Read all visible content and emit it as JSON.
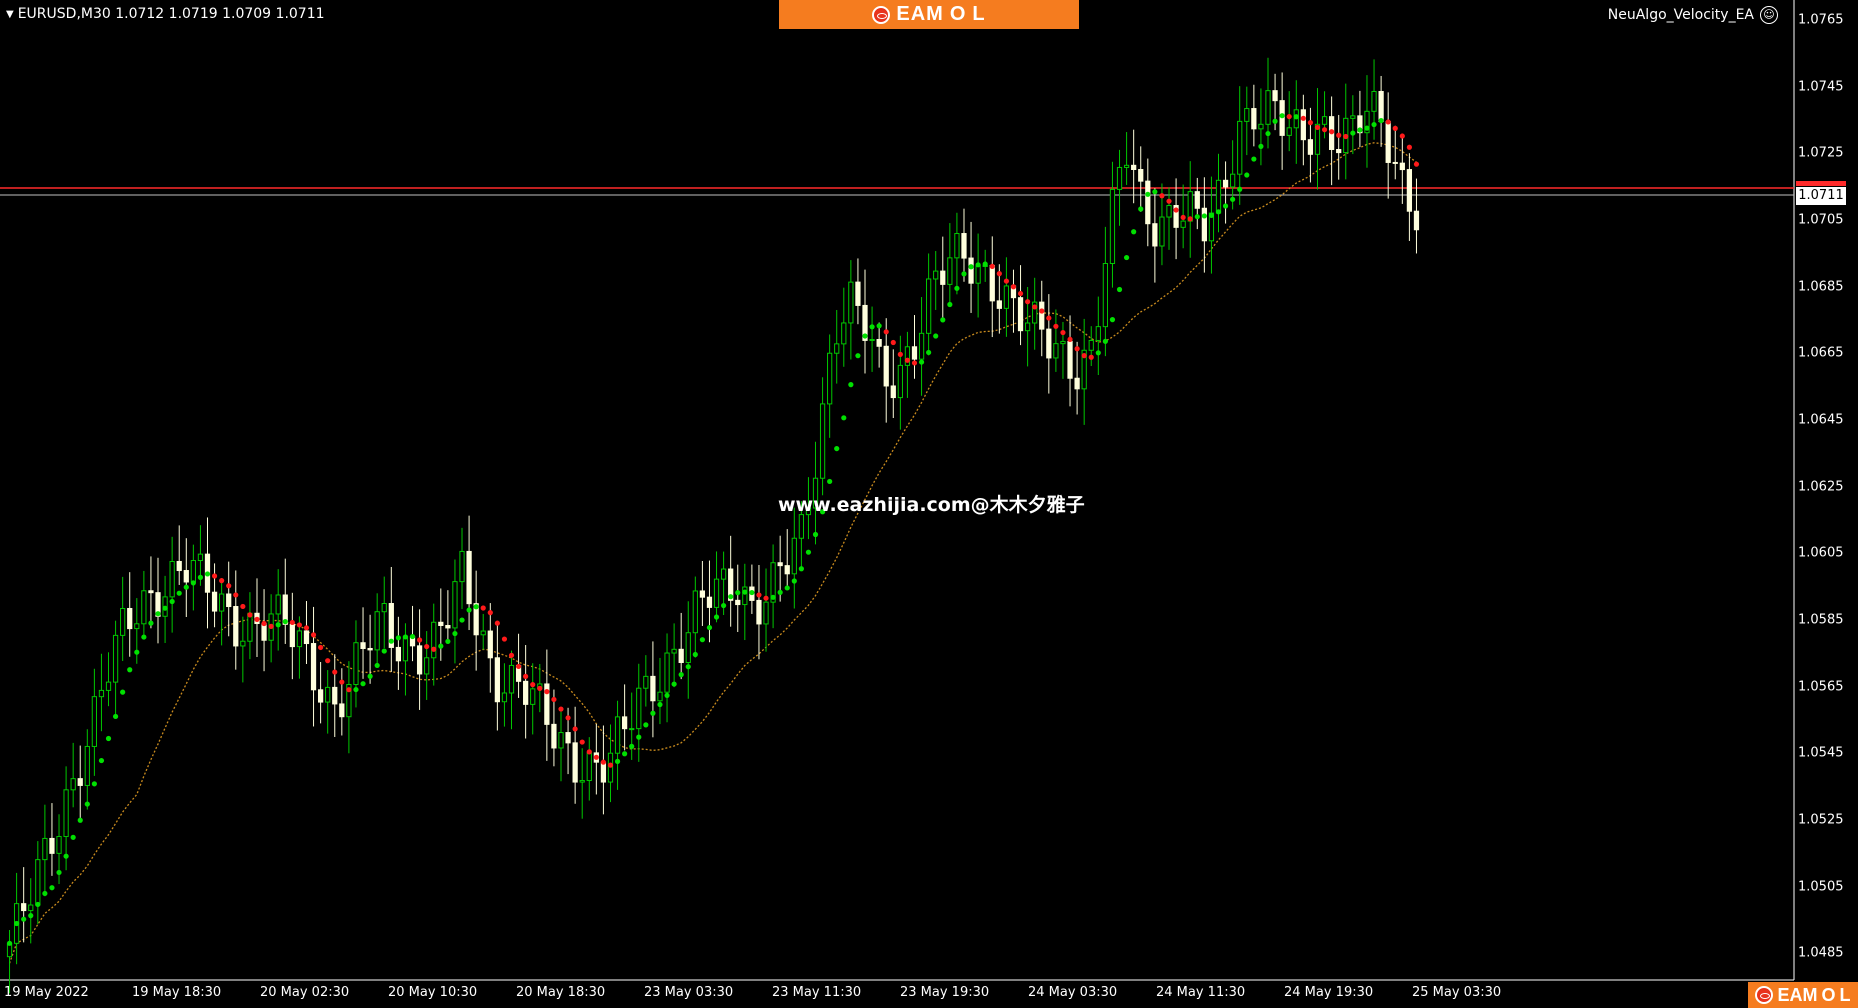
{
  "header": {
    "symbol_info": "EURUSD,M30  1.0712 1.0719 1.0709 1.0711",
    "ea_name": "NeuAlgo_Velocity_EA",
    "smiley": "☺"
  },
  "brand": {
    "name": "EAM",
    "name_mid": "O",
    "name_end": "L",
    "color": "#f57c1f"
  },
  "watermark": {
    "text": "www.eazhijia.com@木木夕雅子"
  },
  "colors": {
    "background": "#000000",
    "bull_candle": "#00c800",
    "bear_candle": "#ffffdd",
    "dots_up": "#00e000",
    "dots_down": "#ff1a1a",
    "ma_line": "#c98b1e",
    "bid_line": "#c0c0c0",
    "ask_line": "#ff2a2a"
  },
  "price_axis": {
    "labels": [
      "1.0765",
      "1.0745",
      "1.0725",
      "1.0705",
      "1.0685",
      "1.0665",
      "1.0645",
      "1.0625",
      "1.0605",
      "1.0585",
      "1.0565",
      "1.0545",
      "1.0525",
      "1.0505",
      "1.0485"
    ],
    "current_price": "1.0711"
  },
  "time_axis": {
    "labels": [
      "19 May 2022",
      "19 May 18:30",
      "20 May 02:30",
      "20 May 10:30",
      "20 May 18:30",
      "23 May 03:30",
      "23 May 11:30",
      "23 May 19:30",
      "24 May 03:30",
      "24 May 11:30",
      "24 May 19:30",
      "25 May 03:30"
    ]
  },
  "chart_data": {
    "type": "candlestick",
    "symbol": "EURUSD",
    "timeframe": "M30",
    "ylim": [
      1.0477,
      1.0771
    ],
    "current_bid": 1.0711,
    "ask_line": 1.0713,
    "approx_closes": [
      1.0488,
      1.0497,
      1.051,
      1.0525,
      1.054,
      1.0552,
      1.0567,
      1.058,
      1.059,
      1.0595,
      1.0598,
      1.06,
      1.0594,
      1.059,
      1.0586,
      1.0584,
      1.0584,
      1.0582,
      1.0577,
      1.057,
      1.056,
      1.0565,
      1.0575,
      1.0585,
      1.058,
      1.0578,
      1.0575,
      1.0583,
      1.0598,
      1.0585,
      1.057,
      1.0566,
      1.0562,
      1.0555,
      1.055,
      1.0545,
      1.0541,
      1.054,
      1.055,
      1.0563,
      1.057,
      1.0575,
      1.058,
      1.059,
      1.0595,
      1.0598,
      1.059,
      1.0592,
      1.06,
      1.061,
      1.064,
      1.0675,
      1.068,
      1.067,
      1.0655,
      1.066,
      1.0672,
      1.0685,
      1.069,
      1.0692,
      1.069,
      1.0688,
      1.068,
      1.0672,
      1.0668,
      1.0665,
      1.0663,
      1.0668,
      1.07,
      1.0725,
      1.071,
      1.0705,
      1.071,
      1.0706,
      1.07,
      1.0712,
      1.0735,
      1.074,
      1.0738,
      1.073,
      1.0728,
      1.0735,
      1.0733,
      1.0732,
      1.0736,
      1.073,
      1.0718,
      1.0711
    ]
  }
}
